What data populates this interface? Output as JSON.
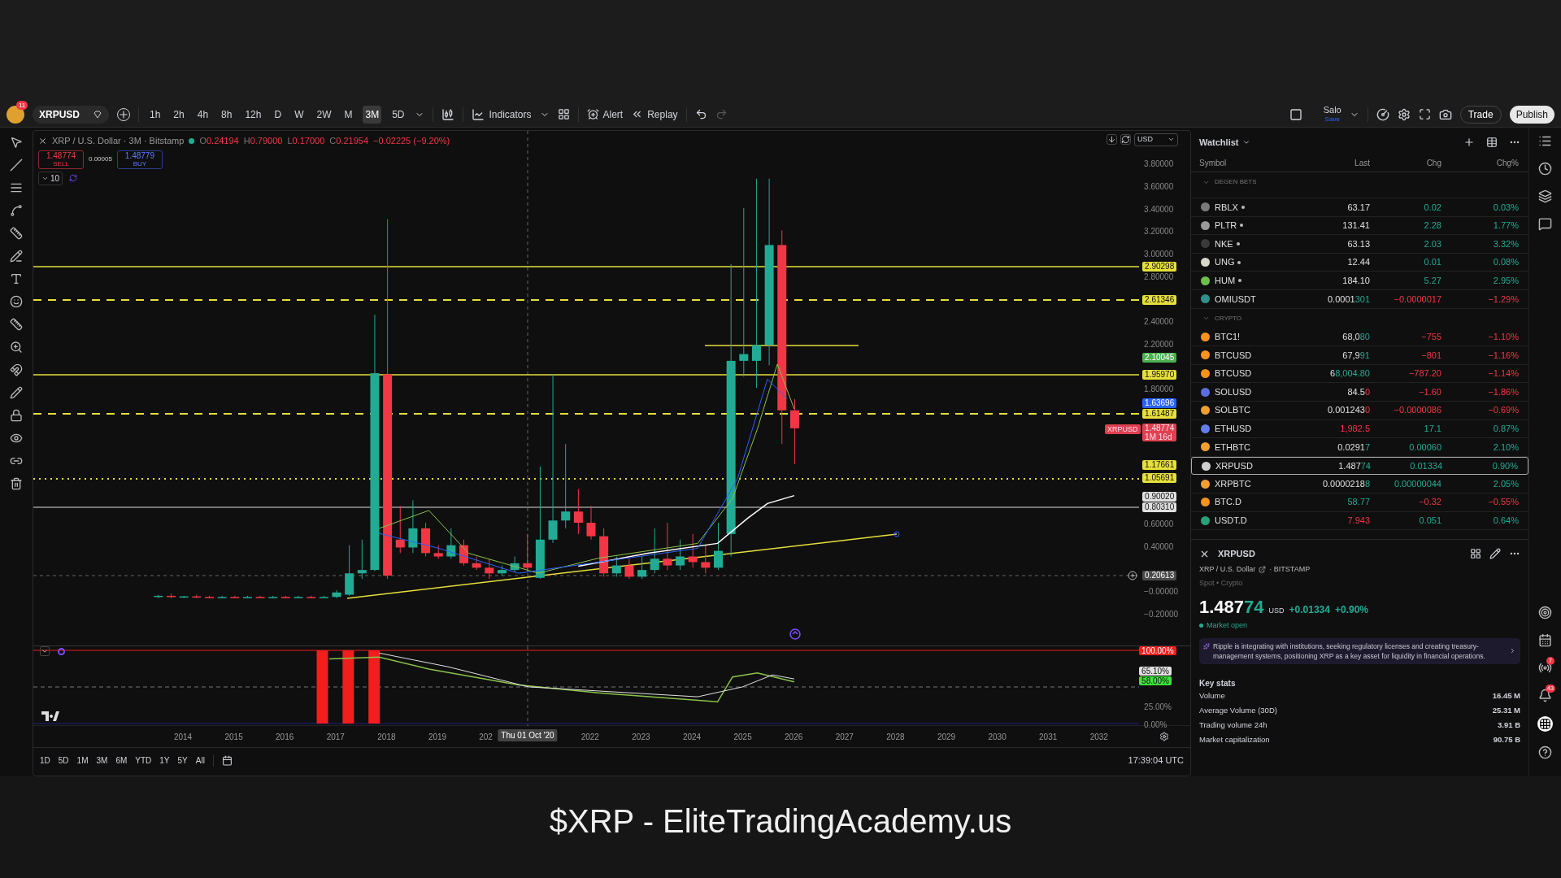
{
  "toolbar": {
    "avatar_badge": "11",
    "symbol": "XRPUSD",
    "intervals": [
      {
        "label": "1h",
        "selected": false
      },
      {
        "label": "2h",
        "selected": false
      },
      {
        "label": "4h",
        "selected": false
      },
      {
        "label": "8h",
        "selected": false
      },
      {
        "label": "12h",
        "selected": false
      },
      {
        "label": "D",
        "selected": false
      },
      {
        "label": "W",
        "selected": false
      },
      {
        "label": "2W",
        "selected": false
      },
      {
        "label": "M",
        "selected": false
      },
      {
        "label": "3M",
        "selected": true
      },
      {
        "label": "5D",
        "selected": false
      }
    ],
    "indicators": "Indicators",
    "alert": "Alert",
    "replay": "Replay",
    "layout_name": "Salo",
    "layout_status": "Save",
    "trade": "Trade",
    "publish": "Publish"
  },
  "chart": {
    "legend": {
      "title": "XRP / U.S. Dollar · 3M · Bitstamp",
      "ohlc": [
        {
          "label": "O",
          "value": "0.24194"
        },
        {
          "label": "H",
          "value": "0.79000"
        },
        {
          "label": "L",
          "value": "0.17000"
        },
        {
          "label": "C",
          "value": "0.21954"
        }
      ],
      "change": "−0.02225 (−9.20%)"
    },
    "sell": {
      "price": "1.48774",
      "label": "SELL"
    },
    "spread": "0.00005",
    "buy": {
      "price": "1.48779",
      "label": "BUY"
    },
    "indicator_count": "10",
    "currency": "USD",
    "price_ticks": [
      "3.80000",
      "3.60000",
      "3.40000",
      "3.20000",
      "3.00000",
      "2.80000",
      "2.40000",
      "2.20000",
      "1.80000",
      "0.60000",
      "0.40000",
      "−0.00000",
      "−0.20000"
    ],
    "price_badges": [
      {
        "text": "2.90298",
        "color": "#e6df3c"
      },
      {
        "text": "2.61346",
        "color": "#e6df3c"
      },
      {
        "text": "2.10045",
        "color": "#4caf50"
      },
      {
        "text": "1.95970",
        "color": "#e6df3c"
      },
      {
        "text": "1.63696",
        "color": "#2962ff"
      },
      {
        "text": "1.61487",
        "color": "#e6df3c"
      },
      {
        "text": "1.17661",
        "color": "#e6df3c"
      },
      {
        "text": "1.05691",
        "color": "#e6df3c"
      },
      {
        "text": "0.90020",
        "color": "#e0e0e0"
      },
      {
        "text": "0.80310",
        "color": "#e0e0e0"
      },
      {
        "text": "0.20613",
        "color": "#4a4a4a"
      }
    ],
    "last_price": {
      "symbol": "XRPUSD",
      "price": "1.48774",
      "countdown": "1M 16d"
    },
    "indicator_ticks": [
      "25.00%",
      "0.00%"
    ],
    "indicator_badges": [
      {
        "text": "100.00%",
        "color": "#f21d1d"
      },
      {
        "text": "65.10%",
        "color": "#e0e0e0"
      },
      {
        "text": "58.00%",
        "color": "#39e639"
      }
    ],
    "time_ticks": [
      "2014",
      "2015",
      "2016",
      "2017",
      "2018",
      "2019",
      "202",
      "2022",
      "2023",
      "2024",
      "2025",
      "2026",
      "2027",
      "2028",
      "2029",
      "2030",
      "2031",
      "2032"
    ],
    "crosshair_time": "Thu 01 Oct '20",
    "ranges": [
      "1D",
      "5D",
      "1M",
      "3M",
      "6M",
      "YTD",
      "1Y",
      "5Y",
      "All"
    ],
    "clock": "17:39:04 UTC"
  },
  "watchlist": {
    "title": "Watchlist",
    "columns": [
      "Symbol",
      "Last",
      "Chg",
      "Chg%"
    ],
    "groups": [
      {
        "title": "DEGEN BETS",
        "expanded": true,
        "rows": [
          {
            "symbol": "RBLX",
            "flagged": true,
            "color": "#7a7a7a",
            "last": "63.17",
            "chg": "0.02",
            "chg_pct": "0.03%",
            "up": true,
            "selected": false
          },
          {
            "symbol": "PLTR",
            "flagged": true,
            "color": "#9a9a9a",
            "last": "131.41",
            "chg": "2.28",
            "chg_pct": "1.77%",
            "up": true,
            "selected": false
          },
          {
            "symbol": "NKE",
            "flagged": true,
            "color": "#3a3a3a",
            "last": "63.13",
            "chg": "2.03",
            "chg_pct": "3.32%",
            "up": true,
            "selected": false
          },
          {
            "symbol": "UNG",
            "flagged": true,
            "color": "#d8d8c8",
            "last": "12.44",
            "chg": "0.01",
            "chg_pct": "0.08%",
            "up": true,
            "selected": false
          },
          {
            "symbol": "HUM",
            "flagged": true,
            "color": "#6cc04a",
            "last": "184.10",
            "chg": "5.27",
            "chg_pct": "2.95%",
            "up": true,
            "selected": false
          },
          {
            "symbol": "OMIUSDT",
            "flagged": false,
            "color": "#2f8f8a",
            "last": "0.0001",
            "last_tail": "301",
            "tail_up": true,
            "chg": "−0.0000017",
            "chg_pct": "−1.29%",
            "up": false,
            "selected": false
          }
        ]
      },
      {
        "title": "CRYPTO",
        "expanded": true,
        "rows": [
          {
            "symbol": "BTC1!",
            "flagged": false,
            "color": "#f7931a",
            "last": "68,0",
            "last_tail": "80",
            "tail_up": true,
            "chg": "−755",
            "chg_pct": "−1.10%",
            "up": false,
            "selected": false
          },
          {
            "symbol": "BTCUSD",
            "flagged": false,
            "color": "#f7931a",
            "last": "67,9",
            "last_tail": "91",
            "tail_up": true,
            "chg": "−801",
            "chg_pct": "−1.16%",
            "up": false,
            "selected": false
          },
          {
            "symbol": "BTCUSD",
            "flagged": false,
            "color": "#f7931a",
            "last": "6",
            "last_tail": "8,004.80",
            "tail_up": true,
            "chg": "−787.20",
            "chg_pct": "−1.14%",
            "up": false,
            "selected": false
          },
          {
            "symbol": "SOLUSD",
            "flagged": false,
            "color": "#5b6ee1",
            "last": "84.5",
            "last_tail": "0",
            "tail_up": false,
            "chg": "−1.60",
            "chg_pct": "−1.86%",
            "up": false,
            "selected": false
          },
          {
            "symbol": "SOLBTC",
            "flagged": false,
            "color": "#f0a030",
            "last": "0.001243",
            "last_tail": "0",
            "tail_up": false,
            "chg": "−0.0000086",
            "chg_pct": "−0.69%",
            "up": false,
            "selected": false
          },
          {
            "symbol": "ETHUSD",
            "flagged": false,
            "color": "#627eea",
            "last_tail": "1,982.5",
            "tail_up": false,
            "chg": "17.1",
            "chg_pct": "0.87%",
            "up": true,
            "selected": false
          },
          {
            "symbol": "ETHBTC",
            "flagged": false,
            "color": "#f0a030",
            "last": "0.0291",
            "last_tail": "7",
            "tail_up": true,
            "chg": "0.00060",
            "chg_pct": "2.10%",
            "up": true,
            "selected": false
          },
          {
            "symbol": "XRPUSD",
            "flagged": false,
            "color": "#d0d0d0",
            "last": "1.487",
            "last_tail": "74",
            "tail_up": true,
            "chg": "0.01334",
            "chg_pct": "0.90%",
            "up": true,
            "selected": true
          },
          {
            "symbol": "XRPBTC",
            "flagged": false,
            "color": "#f0a030",
            "last": "0.0000218",
            "last_tail": "8",
            "tail_up": true,
            "chg": "0.00000044",
            "chg_pct": "2.05%",
            "up": true,
            "selected": false
          },
          {
            "symbol": "BTC.D",
            "flagged": false,
            "color": "#f7931a",
            "last_tail": "58.77",
            "tail_up": true,
            "chg": "−0.32",
            "chg_pct": "−0.55%",
            "up": false,
            "selected": false
          },
          {
            "symbol": "USDT.D",
            "flagged": false,
            "color": "#26a17b",
            "last_tail": "7.943",
            "tail_up": false,
            "chg": "0.051",
            "chg_pct": "0.64%",
            "up": true,
            "selected": false
          }
        ]
      }
    ]
  },
  "details": {
    "symbol": "XRPUSD",
    "name": "XRP / U.S. Dollar",
    "exchange": "· BITSTAMP",
    "category": "Spot • Crypto",
    "price": "1.487",
    "price_tail": "74",
    "currency": "USD",
    "change": "+0.01334",
    "change_pct": "+0.90%",
    "status": "Market open",
    "summary": "Ripple is integrating with institutions, seeking regulatory licenses and creating treasury-management systems, positioning XRP as a key asset for liquidity in financial operations.",
    "stats_title": "Key stats",
    "stats": [
      {
        "label": "Volume",
        "value": "16.45 M"
      },
      {
        "label": "Average Volume (30D)",
        "value": "25.31 M"
      },
      {
        "label": "Trading volume 24h",
        "value": "3.91 B"
      },
      {
        "label": "Market capitalization",
        "value": "90.75 B"
      }
    ]
  },
  "side_badges": {
    "alerts": "7",
    "notifications": "43"
  },
  "caption": "$XRP - EliteTradingAcademy.us"
}
